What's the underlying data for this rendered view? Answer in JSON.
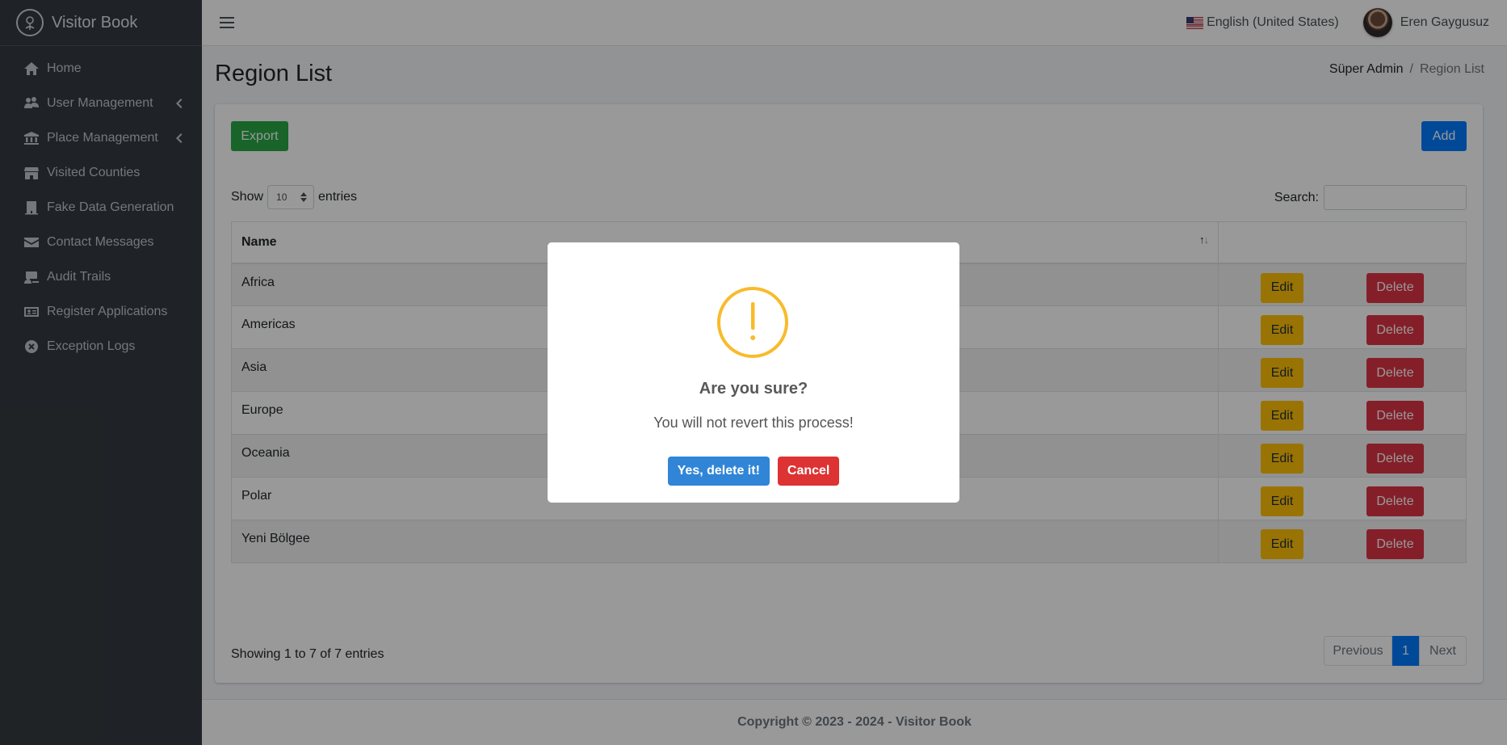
{
  "app": {
    "brand": "Visitor Book"
  },
  "sidebar": {
    "items": [
      {
        "label": "Home",
        "icon": "home-icon",
        "has_children": false
      },
      {
        "label": "User Management",
        "icon": "users-icon",
        "has_children": true
      },
      {
        "label": "Place Management",
        "icon": "landmark-icon",
        "has_children": true
      },
      {
        "label": "Visited Counties",
        "icon": "store-icon",
        "has_children": false
      },
      {
        "label": "Fake Data Generation",
        "icon": "hotel-icon",
        "has_children": false
      },
      {
        "label": "Contact Messages",
        "icon": "envelope-icon",
        "has_children": false
      },
      {
        "label": "Audit Trails",
        "icon": "user-laptop-icon",
        "has_children": false
      },
      {
        "label": "Register Applications",
        "icon": "id-card-icon",
        "has_children": false
      },
      {
        "label": "Exception Logs",
        "icon": "times-circle-icon",
        "has_children": false
      }
    ]
  },
  "navbar": {
    "language": "English (United States)",
    "user_name": "Eren Gaygusuz"
  },
  "page": {
    "title": "Region List",
    "breadcrumb": [
      "Süper Admin",
      "Region List"
    ]
  },
  "toolbar": {
    "export_label": "Export",
    "add_label": "Add"
  },
  "table_controls": {
    "show_label": "Show",
    "page_length": "10",
    "entries_label": "entries",
    "search_label": "Search:",
    "search_value": ""
  },
  "table": {
    "headers": [
      "Name",
      ""
    ],
    "edit_label": "Edit",
    "delete_label": "Delete",
    "rows": [
      "Africa",
      "Americas",
      "Asia",
      "Europe",
      "Oceania",
      "Polar",
      "Yeni Bölgee"
    ]
  },
  "pagination": {
    "info": "Showing 1 to 7 of 7 entries",
    "previous": "Previous",
    "current": "1",
    "next": "Next"
  },
  "footer": {
    "text": "Copyright © 2023 - 2024 - Visitor Book"
  },
  "dialog": {
    "title": "Are you sure?",
    "text": "You will not revert this process!",
    "confirm_label": "Yes, delete it!",
    "cancel_label": "Cancel",
    "icon": "warning-icon"
  },
  "colors": {
    "sidebar_bg": "#343a40",
    "export": "#28a745",
    "add": "#007bff",
    "edit": "#ffc107",
    "delete": "#dc3545",
    "confirm": "#3085d6",
    "cancel": "#dd3333",
    "warning": "#f8bb2b"
  }
}
